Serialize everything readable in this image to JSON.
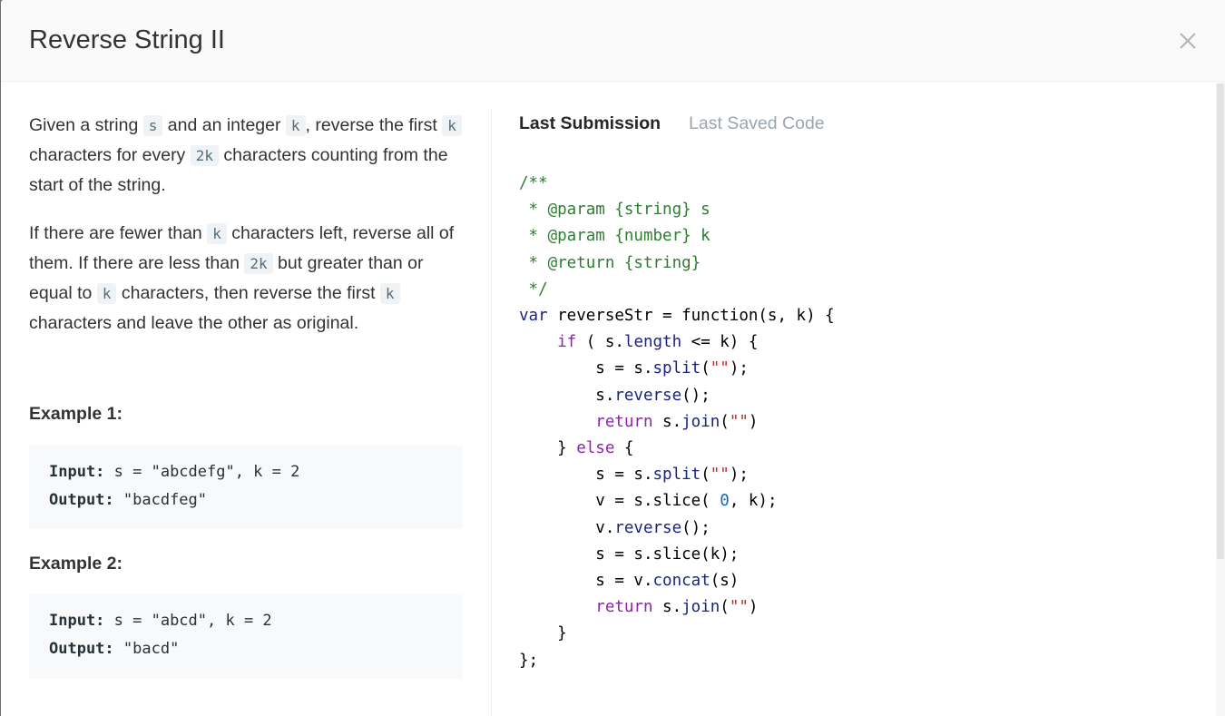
{
  "modal": {
    "title": "Reverse String II"
  },
  "description": {
    "p1": {
      "t1": "Given a string ",
      "c1": "s",
      "t2": " and an integer ",
      "c2": "k",
      "t3": ", reverse the first ",
      "c3": "k",
      "t4": " characters for every ",
      "c4": "2k",
      "t5": " characters counting from the start of the string."
    },
    "p2": {
      "t1": "If there are fewer than ",
      "c1": "k",
      "t2": " characters left, reverse all of them. If there are less than ",
      "c2": "2k",
      "t3": " but greater than or equal to ",
      "c3": "k",
      "t4": " characters, then reverse the first ",
      "c4": "k",
      "t5": " characters and leave the other as original."
    }
  },
  "examples": [
    {
      "title": "Example 1:",
      "input_label": "Input:",
      "input_value": " s = \"abcdefg\", k = 2",
      "output_label": "Output:",
      "output_value": " \"bacdfeg\""
    },
    {
      "title": "Example 2:",
      "input_label": "Input:",
      "input_value": " s = \"abcd\", k = 2",
      "output_label": "Output:",
      "output_value": " \"bacd\""
    }
  ],
  "tabs": [
    {
      "label": "Last Submission",
      "active": true
    },
    {
      "label": "Last Saved Code",
      "active": false
    }
  ],
  "code": {
    "l1": "/**",
    "l2": " * @param {string} s",
    "l3": " * @param {number} k",
    "l4": " * @return {string}",
    "l5": " */",
    "l6a": "var",
    "l6b": " reverseStr = function(s, k) {",
    "l7a": "    if",
    "l7b": " ( s.",
    "l7c": "length",
    "l7d": " <= k) {",
    "l8a": "        s = s.",
    "l8b": "split",
    "l8c": "(",
    "l8d": "\"\"",
    "l8e": ");",
    "l9a": "        s.",
    "l9b": "reverse",
    "l9c": "();",
    "l10a": "        ",
    "l10b": "return",
    "l10c": " s.",
    "l10d": "join",
    "l10e": "(",
    "l10f": "\"\"",
    "l10g": ")",
    "l11a": "    } ",
    "l11b": "else",
    "l11c": " {",
    "l12a": "        s = s.",
    "l12b": "split",
    "l12c": "(",
    "l12d": "\"\"",
    "l12e": ");",
    "l13a": "        v = s.slice( ",
    "l13b": "0",
    "l13c": ", k);",
    "l14a": "        v.",
    "l14b": "reverse",
    "l14c": "();",
    "l15": "        s = s.slice(k);",
    "l16a": "        s = v.",
    "l16b": "concat",
    "l16c": "(s)",
    "l17a": "        ",
    "l17b": "return",
    "l17c": " s.",
    "l17d": "join",
    "l17e": "(",
    "l17f": "\"\"",
    "l17g": ")",
    "l18": "    }",
    "l19": "};"
  }
}
